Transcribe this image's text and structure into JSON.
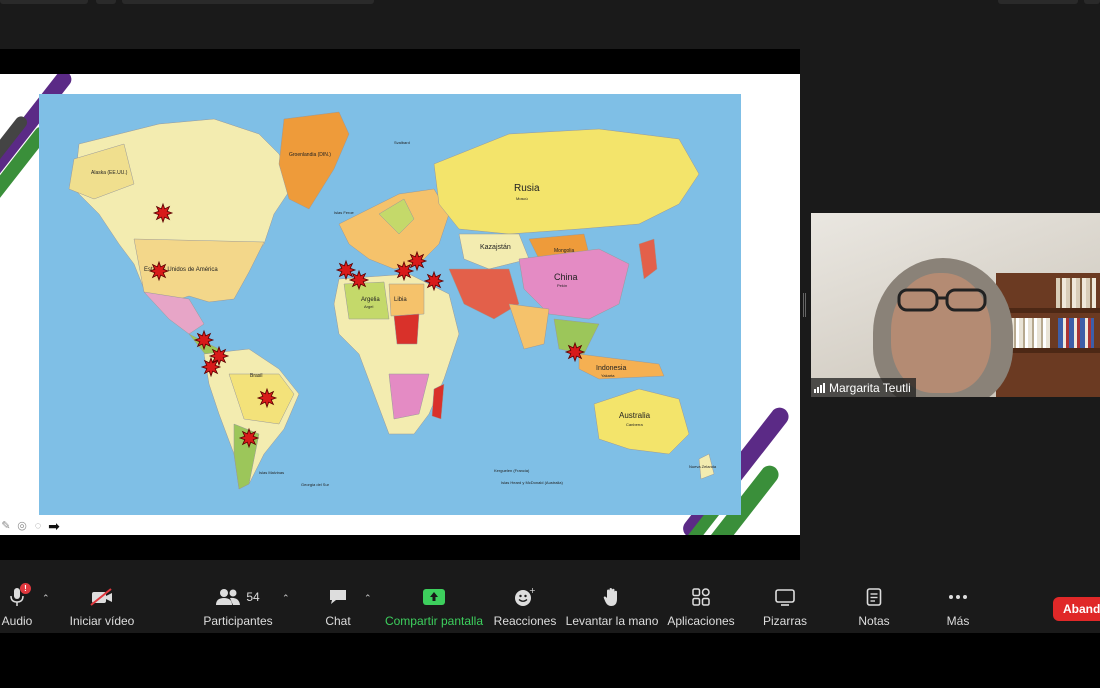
{
  "colors": {
    "ocean": "#7fbfe6",
    "toolbar_bg": "#1a1a1a",
    "share_green": "#3dcf5d",
    "leave_red": "#e02828",
    "stripe_purple": "#5b2a86",
    "stripe_green": "#3a8f3a"
  },
  "map": {
    "labels": {
      "greenland": "Groenlandia (DIN.)",
      "alaska": "Alaska (EE.UU.)",
      "usa": "Estados Unidos de América",
      "russia": "Rusia",
      "moscow": "Moscú",
      "kazakhstan": "Kazajstán",
      "mongolia": "Mongolia",
      "china": "China",
      "beijing": "Pekín",
      "indonesia": "Indonesia",
      "jakarta": "Yakarta",
      "australia": "Australia",
      "canberra": "Canberra",
      "algeria": "Argelia",
      "libya": "Libia",
      "brazil": "Brasil",
      "argelia_city": "Argel",
      "kerguelen": "Kerguelen (Francia)",
      "heard": "Islas Heard y McDonald (Australia)",
      "falklands": "Islas Malvinas",
      "georgia": "Georgia del Sur",
      "nz": "Nueva Zelanda",
      "svalbard": "Svalbard",
      "faroe": "Islas Feroe"
    },
    "marker_icon": "explosion-marker-icon"
  },
  "video": {
    "participant_name": "Margarita Teutli",
    "signal_icon": "signal-strength-icon"
  },
  "toolbar": {
    "audio": {
      "label": "Audio",
      "icon": "microphone-icon",
      "badge": "!"
    },
    "video": {
      "label": "Iniciar vídeo",
      "icon": "video-off-icon"
    },
    "participants": {
      "label": "Participantes",
      "count": "54",
      "icon": "participants-icon"
    },
    "chat": {
      "label": "Chat",
      "icon": "chat-icon"
    },
    "share": {
      "label": "Compartir pantalla",
      "icon": "share-screen-icon"
    },
    "reactions": {
      "label": "Reacciones",
      "icon": "reactions-icon"
    },
    "raise_hand": {
      "label": "Levantar la mano",
      "icon": "hand-icon"
    },
    "apps": {
      "label": "Aplicaciones",
      "icon": "apps-icon"
    },
    "whiteboards": {
      "label": "Pizarras",
      "icon": "whiteboard-icon"
    },
    "notes": {
      "label": "Notas",
      "icon": "notes-icon"
    },
    "more": {
      "label": "Más",
      "icon": "more-icon"
    },
    "leave": {
      "label": "Abandonar"
    },
    "caret": "⌃"
  }
}
